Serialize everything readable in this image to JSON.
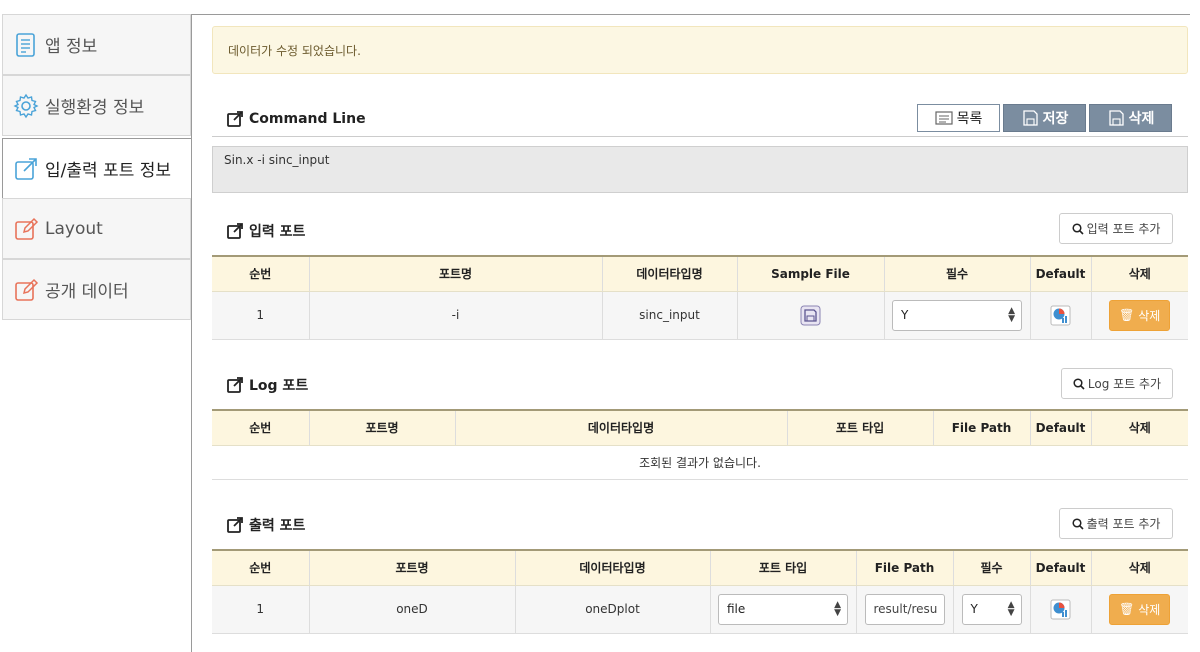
{
  "sidebar": {
    "items": [
      {
        "label": "앱 정보",
        "icon": "document-icon"
      },
      {
        "label": "실행환경 정보",
        "icon": "gear-icon"
      },
      {
        "label": "입/출력 포트 정보",
        "icon": "external-link-icon"
      },
      {
        "label": "Layout",
        "icon": "edit-icon"
      },
      {
        "label": "공개 데이터",
        "icon": "edit-icon"
      }
    ],
    "active_index": 2
  },
  "alert": {
    "message": "데이터가 수정 되었습니다."
  },
  "command": {
    "title": "Command Line",
    "value": "Sin.x -i sinc_input",
    "buttons": {
      "list": "목록",
      "save": "저장",
      "delete": "삭제"
    }
  },
  "input_ports": {
    "title": "입력 포트",
    "add_label": "입력 포트 추가",
    "headers": [
      "순번",
      "포트명",
      "데이터타입명",
      "Sample File",
      "필수",
      "Default",
      "삭제"
    ],
    "rows": [
      {
        "no": "1",
        "name": "-i",
        "datatype": "sinc_input",
        "required": "Y",
        "delete_label": "삭제"
      }
    ]
  },
  "log_ports": {
    "title": "Log 포트",
    "add_label": "Log 포트 추가",
    "headers": [
      "순번",
      "포트명",
      "데이터타입명",
      "포트 타입",
      "File Path",
      "Default",
      "삭제"
    ],
    "empty_message": "조회된 결과가 없습니다."
  },
  "output_ports": {
    "title": "출력 포트",
    "add_label": "출력 포트 추가",
    "headers": [
      "순번",
      "포트명",
      "데이터타입명",
      "포트 타입",
      "File Path",
      "필수",
      "Default",
      "삭제"
    ],
    "rows": [
      {
        "no": "1",
        "name": "oneD",
        "datatype": "oneDplot",
        "port_type": "file",
        "file_path": "result/resu",
        "required": "Y",
        "delete_label": "삭제"
      }
    ]
  },
  "colors": {
    "accent_blue": "#4aa3d8",
    "accent_orange": "#e8735a",
    "button_gray": "#7b8da0",
    "delete_orange": "#f0ad4e",
    "alert_bg": "#fcf7e3",
    "table_header_bg": "#fdf6df"
  }
}
